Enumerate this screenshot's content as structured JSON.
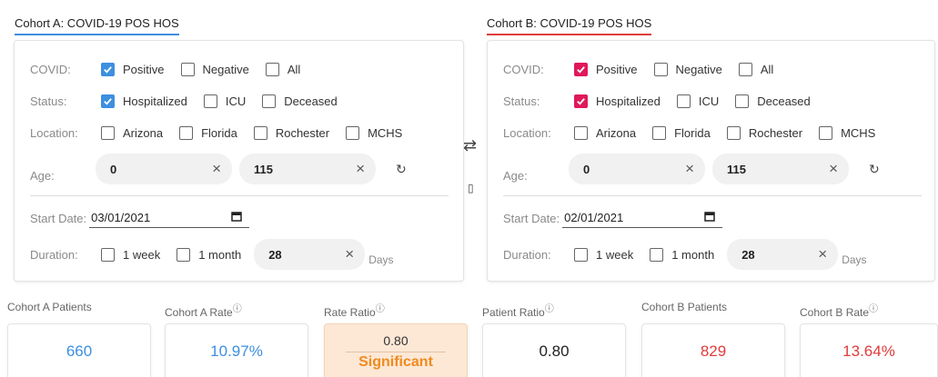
{
  "colors": {
    "cohort_a": "#3d8fe0",
    "cohort_b": "#e0195a",
    "significant": "#f08a1e",
    "a_value": "#3d8fe0",
    "b_value": "#e03b3b"
  },
  "cohort_a": {
    "title": "Cohort A: COVID-19 POS HOS",
    "covid_label": "COVID:",
    "covid_opts": [
      {
        "label": "Positive",
        "checked": true
      },
      {
        "label": "Negative",
        "checked": false
      },
      {
        "label": "All",
        "checked": false
      }
    ],
    "status_label": "Status:",
    "status_opts": [
      {
        "label": "Hospitalized",
        "checked": true
      },
      {
        "label": "ICU",
        "checked": false
      },
      {
        "label": "Deceased",
        "checked": false
      }
    ],
    "location_label": "Location:",
    "location_opts": [
      {
        "label": "Arizona",
        "checked": false
      },
      {
        "label": "Florida",
        "checked": false
      },
      {
        "label": "Rochester",
        "checked": false
      },
      {
        "label": "MCHS",
        "checked": false
      }
    ],
    "age_label": "Age:",
    "age_min": "0",
    "age_max": "115",
    "start_date_label": "Start Date:",
    "start_date": "03/01/2021",
    "duration_label": "Duration:",
    "duration_opts": [
      {
        "label": "1 week",
        "checked": false
      },
      {
        "label": "1 month",
        "checked": false
      }
    ],
    "duration_value": "28",
    "duration_unit": "Days"
  },
  "cohort_b": {
    "title": "Cohort B: COVID-19 POS HOS",
    "covid_label": "COVID:",
    "covid_opts": [
      {
        "label": "Positive",
        "checked": true
      },
      {
        "label": "Negative",
        "checked": false
      },
      {
        "label": "All",
        "checked": false
      }
    ],
    "status_label": "Status:",
    "status_opts": [
      {
        "label": "Hospitalized",
        "checked": true
      },
      {
        "label": "ICU",
        "checked": false
      },
      {
        "label": "Deceased",
        "checked": false
      }
    ],
    "location_label": "Location:",
    "location_opts": [
      {
        "label": "Arizona",
        "checked": false
      },
      {
        "label": "Florida",
        "checked": false
      },
      {
        "label": "Rochester",
        "checked": false
      },
      {
        "label": "MCHS",
        "checked": false
      }
    ],
    "age_label": "Age:",
    "age_min": "0",
    "age_max": "115",
    "start_date_label": "Start Date:",
    "start_date": "02/01/2021",
    "duration_label": "Duration:",
    "duration_opts": [
      {
        "label": "1 week",
        "checked": false
      },
      {
        "label": "1 month",
        "checked": false
      }
    ],
    "duration_value": "28",
    "duration_unit": "Days"
  },
  "icons": {
    "clear": "×",
    "reset": "↻",
    "swap": "⇄",
    "compare": "▯",
    "calendar": "calendar-icon",
    "info": "ⓘ"
  },
  "stats": {
    "a_patients_label": "Cohort A Patients",
    "a_patients": "660",
    "a_rate_label": "Cohort A Rate",
    "a_rate": "10.97%",
    "rate_ratio_label": "Rate Ratio",
    "rate_ratio": "0.80",
    "rate_ratio_sig": "Significant",
    "patient_ratio_label": "Patient Ratio",
    "patient_ratio": "0.80",
    "b_patients_label": "Cohort B Patients",
    "b_patients": "829",
    "b_rate_label": "Cohort B Rate",
    "b_rate": "13.64%"
  }
}
